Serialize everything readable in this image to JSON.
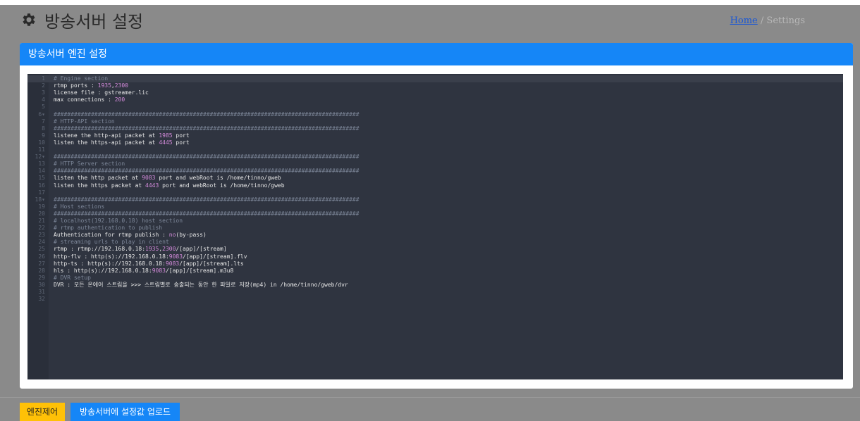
{
  "header": {
    "title": "방송서버 설정",
    "breadcrumb_home": "Home",
    "breadcrumb_sep": "/",
    "breadcrumb_current": "Settings"
  },
  "card": {
    "title": "방송서버 엔진 설정"
  },
  "editor": {
    "lines": [
      [
        [
          "c",
          "# Engine section"
        ]
      ],
      [
        [
          "k",
          "rtmp ports : "
        ],
        [
          "n",
          "1935"
        ],
        [
          "k",
          ","
        ],
        [
          "n",
          "2300"
        ]
      ],
      [
        [
          "k",
          "license file : gstreamer.lic"
        ]
      ],
      [
        [
          "k",
          "max connections : "
        ],
        [
          "n",
          "200"
        ]
      ],
      [],
      [
        [
          "c",
          "##########################################################################################"
        ]
      ],
      [
        [
          "c",
          "# HTTP-API section"
        ]
      ],
      [
        [
          "c",
          "##########################################################################################"
        ]
      ],
      [
        [
          "k",
          "listene the http-api packet at "
        ],
        [
          "n",
          "1985"
        ],
        [
          "k",
          " port"
        ]
      ],
      [
        [
          "k",
          "listen the https-api packet at "
        ],
        [
          "n",
          "4445"
        ],
        [
          "k",
          " port"
        ]
      ],
      [],
      [
        [
          "c",
          "##########################################################################################"
        ]
      ],
      [
        [
          "c",
          "# HTTP Server section"
        ]
      ],
      [
        [
          "c",
          "##########################################################################################"
        ]
      ],
      [
        [
          "k",
          "listen the http packet at "
        ],
        [
          "n",
          "9083"
        ],
        [
          "k",
          " port and webRoot is /home/tinno/gweb"
        ]
      ],
      [
        [
          "k",
          "listen the https packet at "
        ],
        [
          "n",
          "4443"
        ],
        [
          "k",
          " port and webRoot is /home/tinno/gweb"
        ]
      ],
      [],
      [
        [
          "c",
          "##########################################################################################"
        ]
      ],
      [
        [
          "c",
          "# Host sections"
        ]
      ],
      [
        [
          "c",
          "##########################################################################################"
        ]
      ],
      [
        [
          "c",
          "# localhost(192.168.0.18) host section"
        ]
      ],
      [
        [
          "c",
          "# rtmp authentication to publish"
        ]
      ],
      [
        [
          "k",
          "Authentication for rtmp publish : "
        ],
        [
          "n",
          "no"
        ],
        [
          "k",
          "(by-pass)"
        ]
      ],
      [
        [
          "c",
          "# streaming urls to play in client"
        ]
      ],
      [
        [
          "k",
          "rtmp : rtmp://192.168.0.18:"
        ],
        [
          "n",
          "1935"
        ],
        [
          "k",
          ","
        ],
        [
          "n",
          "2300"
        ],
        [
          "k",
          "/[app]/[stream]"
        ]
      ],
      [
        [
          "k",
          "http-flv : http(s)://192.168.0.18:"
        ],
        [
          "n",
          "9083"
        ],
        [
          "k",
          "/[app]/[stream].flv"
        ]
      ],
      [
        [
          "k",
          "http-ts : http(s)://192.168.0.18:"
        ],
        [
          "n",
          "9083"
        ],
        [
          "k",
          "/[app]/[stream].lts"
        ]
      ],
      [
        [
          "k",
          "hls : http(s)://192.168.0.18:"
        ],
        [
          "n",
          "9083"
        ],
        [
          "k",
          "/[app]/[stream].m3u8"
        ]
      ],
      [
        [
          "c",
          "# DVR setup"
        ]
      ],
      [
        [
          "k",
          "DVR : 모든 온에어 스트림을 >>> 스트림별로 송출되는 동안 한 파일로 저장(mp4) in /home/tinno/gweb/dvr"
        ]
      ],
      [],
      []
    ],
    "fold_lines": [
      6,
      12,
      18
    ]
  },
  "footer": {
    "engine_button": "엔진제어",
    "upload_button": "방송서버에 설정값 업로드"
  },
  "colors": {
    "primary": "#1586f7",
    "warning": "#ffc107",
    "editor_bg": "#2f3440",
    "number": "#d28ad9",
    "comment": "#7d8799"
  }
}
